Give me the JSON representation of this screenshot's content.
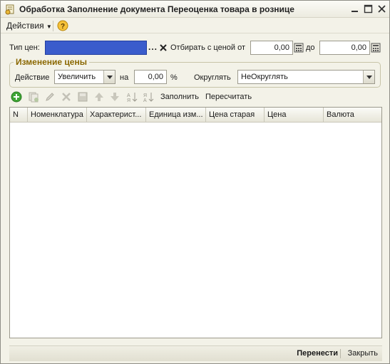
{
  "window": {
    "title": "Обработка  Заполнение документа Переоценка товара в рознице",
    "icon": "processing-icon",
    "controls": [
      "minimize-icon",
      "maximize-icon",
      "close-icon"
    ]
  },
  "menu": {
    "actions_label": "Действия",
    "help_icon": "help-icon"
  },
  "filter": {
    "price_type_label": "Тип цен:",
    "price_type_value": "",
    "select_button": "...",
    "price_from_label": "Отбирать с ценой от",
    "price_from_value": "0,00",
    "price_to_label": "до",
    "price_to_value": "0,00"
  },
  "price_change": {
    "group_title": "Изменение цены",
    "action_label": "Действие",
    "action_value": "Увеличить",
    "by_label": "на",
    "percent_value": "0,00",
    "percent_sign": "%",
    "round_label": "Округлять",
    "round_value": "НеОкруглять"
  },
  "toolbar": {
    "icons": [
      "add-icon",
      "copy-icon",
      "edit-icon",
      "delete-icon",
      "save-icon",
      "move-up-icon",
      "move-down-icon",
      "sort-asc-icon",
      "sort-desc-icon"
    ],
    "fill_label": "Заполнить",
    "recalc_label": "Пересчитать"
  },
  "table": {
    "columns": [
      "N",
      "Номенклатура",
      "Характерист...",
      "Единица изм...",
      "Цена старая",
      "Цена",
      "Валюта"
    ],
    "rows": []
  },
  "footer": {
    "transfer_label": "Перенести",
    "close_label": "Закрыть"
  },
  "colors": {
    "selection": "#3a5ccc",
    "group_title": "#8a6700",
    "window_bg": "#f3f2e8",
    "add_green": "#3fa535"
  }
}
